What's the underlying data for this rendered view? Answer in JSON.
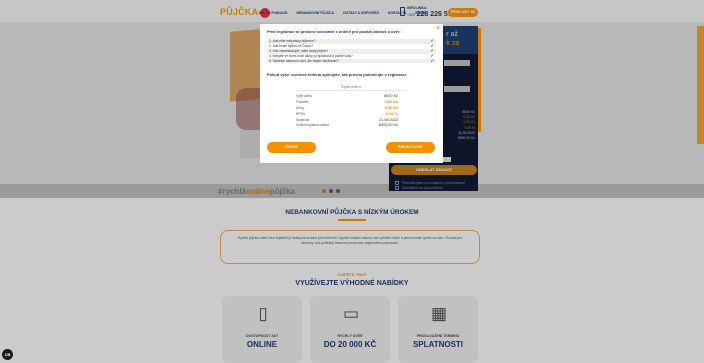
{
  "header": {
    "logo_text": "PŮJČKA",
    "nav": [
      "JAK TO FUNGUJE",
      "NEBANKOVNÍ PŮJČKA",
      "DOTAZY A ODPOVĚDI",
      "KONTAKTY",
      "BLOG"
    ],
    "phone_label": "INFOLINKA",
    "phone_prefix": "+420",
    "phone_number": "228 226 571",
    "login_label": "PŘIHLÁSIT SE"
  },
  "hero": {
    "hashtag_pre": "#rychlá",
    "hashtag_mid": "online",
    "hashtag_post": "půjčka"
  },
  "calculator": {
    "title_line1": "r až",
    "title_line2": "k za",
    "select1": "",
    "select2": "",
    "result_values": [
      "8000 Kč",
      "0,00 Kč",
      "0,00 Kč",
      "0,00 %",
      "21.08.2022",
      "8000,00 Kč"
    ],
    "submit_label": "ODESLAT ŽÁDOST",
    "check1": "Přečetl/a jsem a souhlasím s podmínkami",
    "check2": "Souhlasím se zpracováním"
  },
  "body": {
    "title": "NEBANKOVNÍ PŮJČKA S NÍZKÝM ÚROKEM",
    "info_text": "Rychlá půjčka online bez doplatků je dostupná snadno přes internet. Vyplňte krátkou žádost, vše vyřídíte online a peníze máte rychle na účtu. Vhodná pro všechny, kdo potřebují finanční pomoc bez zbytečného papírování.",
    "sub_orange": "ZJISTĚTE, PROČ",
    "sub_title": "VYUŽÍVEJTE VÝHODNÉ NABÍDKY",
    "features": [
      {
        "icon": "phone-icon",
        "glyph": "▯",
        "line1": "DOSTUPNOST 24/7",
        "line2": "ONLINE"
      },
      {
        "icon": "wallet-icon",
        "glyph": "▭",
        "line1": "RYCHLÝ ÚVĚR",
        "line2": "DO 20 000 KČ"
      },
      {
        "icon": "calendar-icon",
        "glyph": "▦",
        "line1": "PRODLOUŽENÍ TERMÍNU",
        "line2": "SPLATNOSTI"
      }
    ]
  },
  "modal": {
    "title": "Před registrací se prosíme seznamte s kritérii pro podání žádosti o úvěr:",
    "criteria": [
      "1. Jste plně svéprávný příjemce?",
      "2. Jste trvale bydlící ve Česku?",
      "3. Jste zaměstnaný/á, máte trvalý příjem?",
      "4. Nemáte ve svém okolí dluhy po splatnosti a platíte včas?",
      "5. Vlastníte bankovní účet, ale nejste insolventní?"
    ],
    "note": "Pokud výše uvedená kritéria splňujete, tak prosím pokračujte v registraci.",
    "summary_title": "Výše úvěru",
    "summary": [
      {
        "label": "Výše úvěru",
        "value": "8000 Kč",
        "accent": false
      },
      {
        "label": "Poplatek",
        "value": "0,00 Kč",
        "accent": true
      },
      {
        "label": "Úroky",
        "value": "0,00 Kč",
        "accent": true
      },
      {
        "label": "RPSN",
        "value": "0,00 %",
        "accent": true
      },
      {
        "label": "Splatnost",
        "value": "21.08.2022",
        "accent": false
      },
      {
        "label": "Celková splatná částka",
        "value": "8000,00 Kč",
        "accent": false
      }
    ],
    "cancel_label": "ZRUŠIT",
    "continue_label": "POKRAČOVAT",
    "close_glyph": "×"
  },
  "colors": {
    "accent": "#f39200",
    "navy": "#203a6e",
    "check": "#2e9e44"
  }
}
